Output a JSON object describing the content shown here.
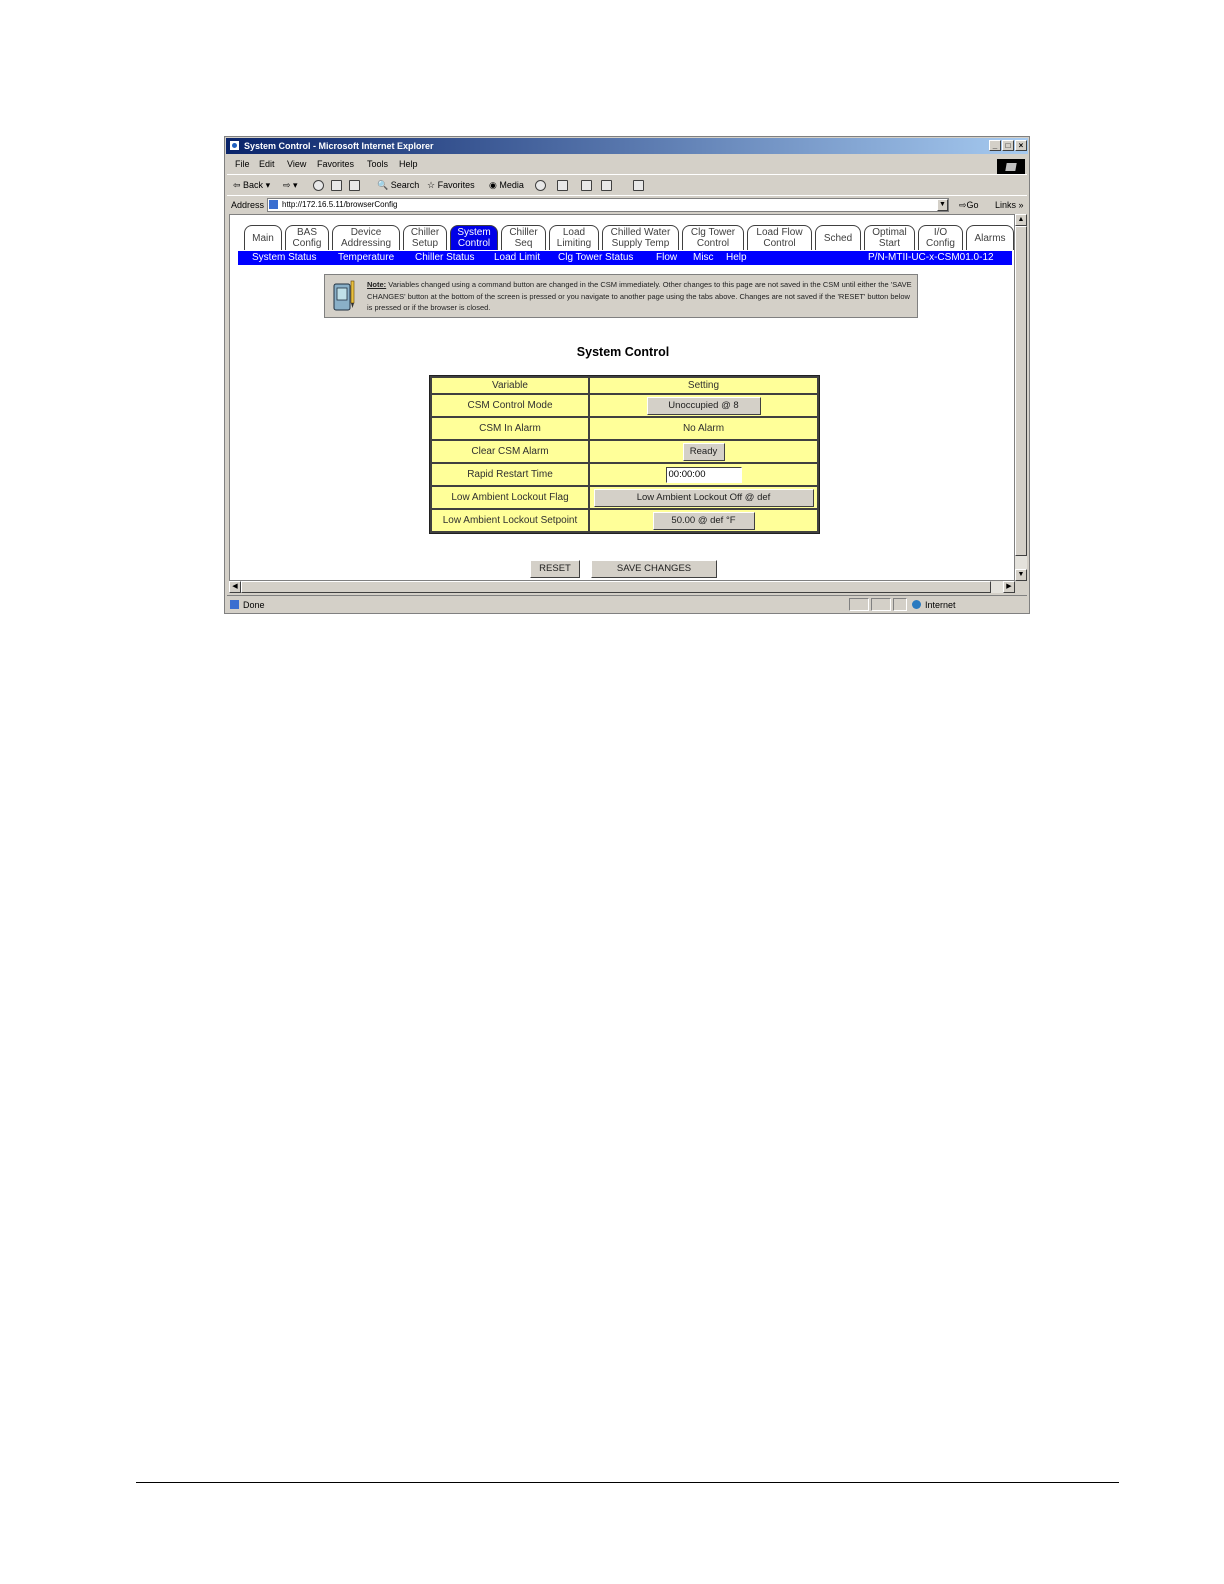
{
  "window": {
    "title": "System Control - Microsoft Internet Explorer",
    "controls": [
      "_",
      "□",
      "×"
    ]
  },
  "menu": [
    "File",
    "Edit",
    "View",
    "Favorites",
    "Tools",
    "Help"
  ],
  "toolbar": {
    "back": "Back",
    "search": "Search",
    "favorites": "Favorites",
    "media": "Media"
  },
  "address": {
    "label": "Address",
    "url": "http://172.16.5.11/browserConfig",
    "go": "Go",
    "links": "Links"
  },
  "tabs": [
    {
      "label": "Main"
    },
    {
      "label": "BAS\nConfig"
    },
    {
      "label": "Device\nAddressing"
    },
    {
      "label": "Chiller\nSetup"
    },
    {
      "label": "System\nControl",
      "active": true
    },
    {
      "label": "Chiller\nSeq"
    },
    {
      "label": "Load\nLimiting"
    },
    {
      "label": "Chilled Water\nSupply Temp"
    },
    {
      "label": "Clg Tower\nControl"
    },
    {
      "label": "Load Flow\nControl"
    },
    {
      "label": "Sched"
    },
    {
      "label": "Optimal\nStart"
    },
    {
      "label": "I/O\nConfig"
    },
    {
      "label": "Alarms"
    }
  ],
  "subnav": {
    "links": [
      "System Status",
      "Temperature",
      "Chiller Status",
      "Load Limit",
      "Clg Tower Status",
      "Flow",
      "Misc",
      "Help"
    ],
    "part_number": "P/N-MTII-UC-x-CSM01.0-12"
  },
  "note": {
    "label": "Note:",
    "text": " Variables changed using a command button are changed in the CSM immediately.  Other changes to this page are not saved in the CSM until either the 'SAVE CHANGES' button at the bottom of the screen is pressed or you navigate to another page using the tabs above.  Changes are not saved if the 'RESET' button below is pressed or if the browser is closed."
  },
  "page_title": "System Control",
  "table": {
    "headers": {
      "variable": "Variable",
      "setting": "Setting"
    },
    "rows": [
      {
        "variable": "CSM Control Mode",
        "setting": "Unoccupied @ 8",
        "type": "button"
      },
      {
        "variable": "CSM In Alarm",
        "setting": "No Alarm",
        "type": "text"
      },
      {
        "variable": "Clear CSM Alarm",
        "setting": "Ready",
        "type": "button"
      },
      {
        "variable": "Rapid Restart Time",
        "setting": "00:00:00",
        "type": "input"
      },
      {
        "variable": "Low Ambient Lockout Flag",
        "setting": "Low Ambient Lockout Off @ def",
        "type": "button"
      },
      {
        "variable": "Low Ambient Lockout Setpoint",
        "setting": "50.00 @ def °F",
        "type": "button"
      }
    ]
  },
  "actions": {
    "reset": "RESET",
    "save": "SAVE CHANGES"
  },
  "status": {
    "text": "Done",
    "zone": "Internet"
  },
  "colors": {
    "tab_active": "#0000e8",
    "subnav": "#0000ff",
    "table_cell": "#ffff99"
  }
}
